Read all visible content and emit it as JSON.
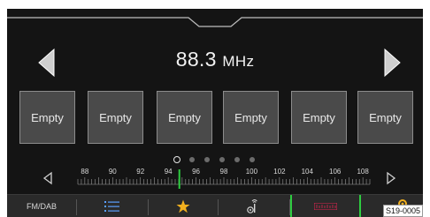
{
  "frequency": {
    "value": "88.3",
    "unit": "MHz"
  },
  "presets": [
    "Empty",
    "Empty",
    "Empty",
    "Empty",
    "Empty",
    "Empty"
  ],
  "page_indicator": {
    "total": 6,
    "active_index": 0
  },
  "tuner": {
    "labels": [
      "88",
      "90",
      "92",
      "94",
      "96",
      "98",
      "100",
      "102",
      "104",
      "106",
      "108"
    ],
    "current_frequency_mhz": 94.8,
    "range_mhz": [
      87.5,
      108.5
    ]
  },
  "toolbar": {
    "band_label": "FM/DAB",
    "list_icon": "list-icon",
    "favorites_icon": "star-icon",
    "antenna_icon": "antenna-signal-icon",
    "manual_tune_icon": "manual-tune-scale-icon",
    "settings_icon": "settings-gear-icon"
  },
  "image_code": "S19-0005",
  "colors": {
    "background": "#141414",
    "preset_fill": "#4a4a4a",
    "preset_border": "#8c8c8c",
    "accent_green": "#2ecc40",
    "star": "#f2b01e",
    "manual_tune": "#e0234e"
  }
}
